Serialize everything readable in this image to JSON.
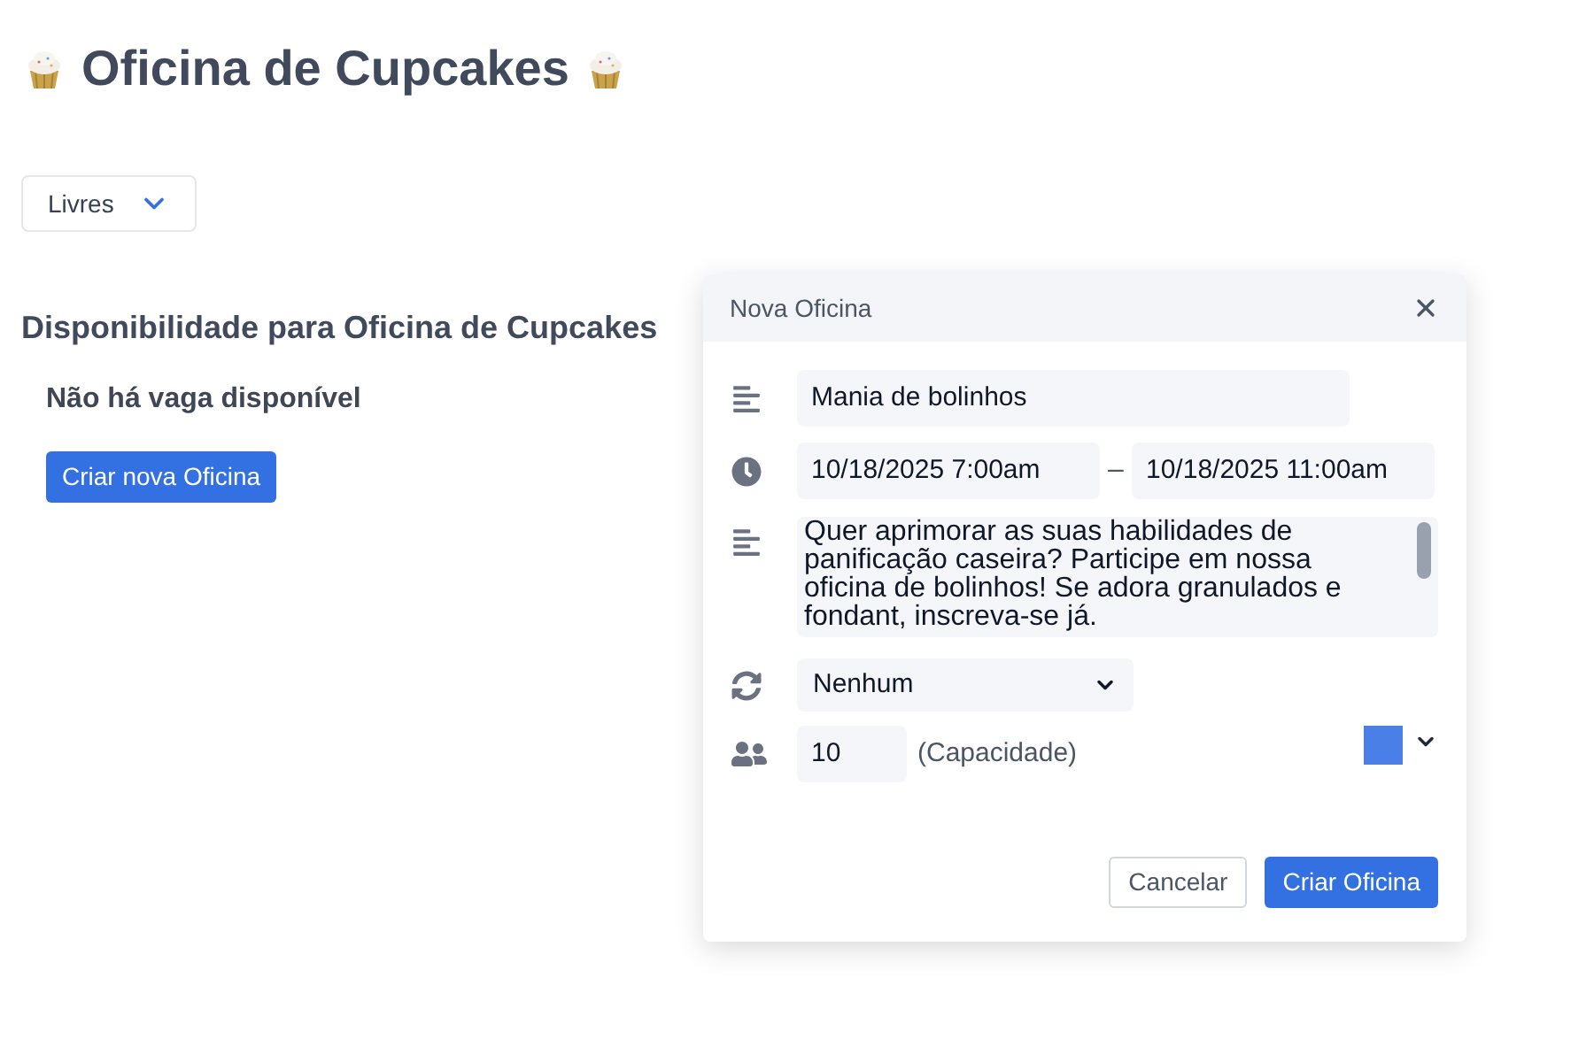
{
  "page": {
    "title": "Oficina de Cupcakes"
  },
  "filter": {
    "value": "Livres"
  },
  "availability": {
    "heading": "Disponibilidade para Oficina de Cupcakes",
    "message": "Não há vaga disponível",
    "create_button": "Criar nova Oficina"
  },
  "dialog": {
    "title": "Nova Oficina",
    "name": "Mania de bolinhos",
    "start": "10/18/2025 7:00am",
    "separator": "–",
    "end": "10/18/2025 11:00am",
    "description": "Quer aprimorar as suas habilidades de panificação caseira? Participe em nossa oficina de bolinhos! Se adora granulados e fondant, inscreva-se já.",
    "recurrence": "Nenhum",
    "capacity": "10",
    "capacity_label": "(Capacidade)",
    "color": "#4a7fe8",
    "buttons": [
      {
        "label": "Cancelar",
        "kind": "secondary"
      },
      {
        "label": "Criar Oficina",
        "kind": "primary"
      }
    ]
  }
}
